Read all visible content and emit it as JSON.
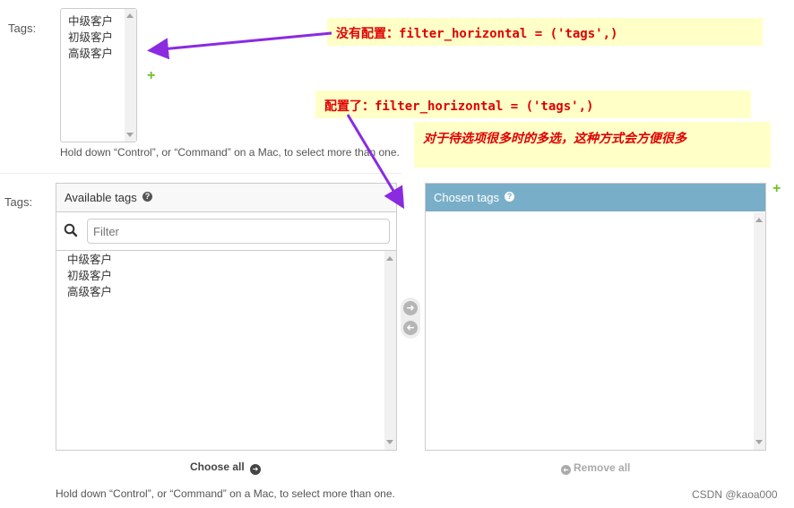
{
  "field_label": "Tags:",
  "plain_select": {
    "options": [
      "中级客户",
      "初级客户",
      "高级客户"
    ],
    "help_text": "Hold down “Control”, or “Command” on a Mac, to select more than one."
  },
  "filter_widget": {
    "available_title": "Available tags",
    "filter_placeholder": "Filter",
    "available_options": [
      "中级客户",
      "初级客户",
      "高级客户"
    ],
    "chosen_title": "Chosen tags",
    "choose_all": "Choose all",
    "remove_all": "Remove all",
    "help_text": "Hold down “Control”, or “Command” on a Mac, to select more than one."
  },
  "annotations": {
    "not_configured": "没有配置：filter_horizontal = ('tags',)",
    "configured": "配置了：filter_horizontal = ('tags',)",
    "note": "对于待选项很多时的多选，这种方式会方便很多"
  },
  "watermark": "CSDN @kaoa000",
  "colors": {
    "chosen_header": "#79aec8",
    "add_green": "#70bf2b",
    "annotation_arrow": "#8a2be2",
    "annotation_text": "#e00000"
  }
}
